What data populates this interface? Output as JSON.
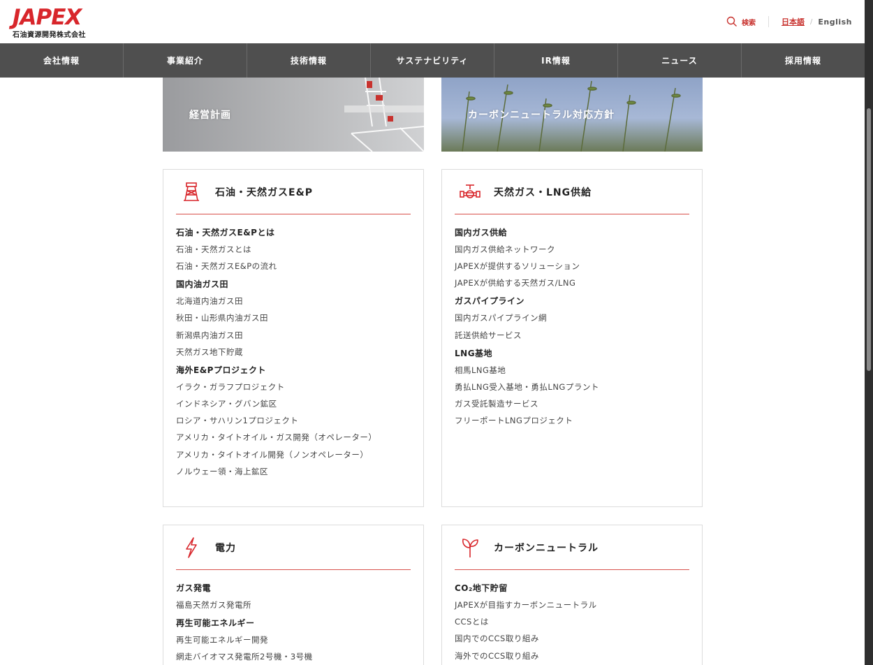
{
  "header": {
    "logo_mark": "JAPEX",
    "logo_sub": "石油資源開発株式会社",
    "search_label": "検索",
    "lang_ja": "日本語",
    "lang_sep": "/",
    "lang_en": "English"
  },
  "nav": {
    "items": [
      "会社情報",
      "事業紹介",
      "技術情報",
      "サステナビリティ",
      "IR情報",
      "ニュース",
      "採用情報"
    ]
  },
  "banners": {
    "left": "経営計画",
    "right": "カーボンニュートラル対応方針"
  },
  "cards": {
    "ep": {
      "title": "石油・天然ガスE&P",
      "groups": [
        {
          "title": "石油・天然ガスE&Pとは",
          "links": [
            "石油・天然ガスとは",
            "石油・天然ガスE&Pの流れ"
          ]
        },
        {
          "title": "国内油ガス田",
          "links": [
            "北海道内油ガス田",
            "秋田・山形県内油ガス田",
            "新潟県内油ガス田",
            "天然ガス地下貯蔵"
          ]
        },
        {
          "title": "海外E&Pプロジェクト",
          "links": [
            "イラク・ガラフプロジェクト",
            "インドネシア・グバン鉱区",
            "ロシア・サハリン1プロジェクト",
            "アメリカ・タイトオイル・ガス開発（オペレーター）",
            "アメリカ・タイトオイル開発（ノンオペレーター）",
            "ノルウェー領・海上鉱区"
          ]
        }
      ]
    },
    "lng": {
      "title": "天然ガス・LNG供給",
      "groups": [
        {
          "title": "国内ガス供給",
          "links": [
            "国内ガス供給ネットワーク",
            "JAPEXが提供するソリューション",
            "JAPEXが供給する天然ガス/LNG"
          ]
        },
        {
          "title": "ガスパイプライン",
          "links": [
            "国内ガスパイプライン網",
            "託送供給サービス"
          ]
        },
        {
          "title": "LNG基地",
          "links": [
            "相馬LNG基地",
            "勇払LNG受入基地・勇払LNGプラント",
            "ガス受託製造サービス",
            "フリーポートLNGプロジェクト"
          ]
        }
      ]
    },
    "power": {
      "title": "電力",
      "groups": [
        {
          "title": "ガス発電",
          "links": [
            "福島天然ガス発電所"
          ]
        },
        {
          "title": "再生可能エネルギー",
          "links": [
            "再生可能エネルギー開発",
            "網走バイオマス発電所2号機・3号機"
          ]
        }
      ]
    },
    "carbon": {
      "title": "カーボンニュートラル",
      "groups": [
        {
          "title": "CO₂地下貯留",
          "links": [
            "JAPEXが目指すカーボンニュートラル",
            "CCSとは",
            "国内でのCCS取り組み",
            "海外でのCCS取り組み"
          ]
        }
      ]
    }
  },
  "colors": {
    "brand_red": "#d8262b",
    "nav_bg": "#4f4f4f",
    "accent_line": "#d8504b"
  },
  "icons": {
    "search": "search-icon",
    "ep": "oil-derrick-icon",
    "lng": "gas-valve-icon",
    "power": "lightning-icon",
    "carbon": "leaf-sprout-icon"
  }
}
